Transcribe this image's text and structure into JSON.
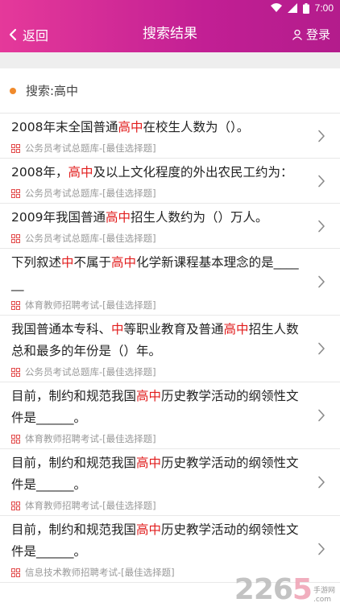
{
  "status_bar": {
    "time": "7:00"
  },
  "header": {
    "back_label": "返回",
    "title": "搜索结果",
    "login_label": "登录"
  },
  "search": {
    "label": "搜索:高中"
  },
  "results": [
    {
      "parts": [
        [
          "2008年末全国普通",
          0
        ],
        [
          "高中",
          1
        ],
        [
          "在校生人数为（）。",
          0
        ]
      ],
      "source": "公务员考试总题库-[最佳选择题]"
    },
    {
      "parts": [
        [
          "2008年，",
          0
        ],
        [
          "高中",
          1
        ],
        [
          "及以上文化程度的外出农民工约为：",
          0
        ]
      ],
      "source": "公务员考试总题库-[最佳选择题]"
    },
    {
      "parts": [
        [
          "2009年我国普通",
          0
        ],
        [
          "高中",
          1
        ],
        [
          "招生人数约为（）万人。",
          0
        ]
      ],
      "source": "公务员考试总题库-[最佳选择题]"
    },
    {
      "parts": [
        [
          "下列叙述",
          0
        ],
        [
          "中",
          1
        ],
        [
          "不属于",
          0
        ],
        [
          "高中",
          1
        ],
        [
          "化学新课程基本理念的是______",
          0
        ]
      ],
      "source": "体育教师招聘考试-[最佳选择题]"
    },
    {
      "parts": [
        [
          "我国普通本专科、",
          0
        ],
        [
          "中",
          1
        ],
        [
          "等职业教育及普通",
          0
        ],
        [
          "高中",
          1
        ],
        [
          "招生人数总和最多的年份是（）年。",
          0
        ]
      ],
      "source": "公务员考试总题库-[最佳选择题]"
    },
    {
      "parts": [
        [
          "目前，制约和规范我国",
          0
        ],
        [
          "高中",
          1
        ],
        [
          "历史教学活动的纲领性文件是______。",
          0
        ]
      ],
      "source": "体育教师招聘考试-[最佳选择题]"
    },
    {
      "parts": [
        [
          "目前，制约和规范我国",
          0
        ],
        [
          "高中",
          1
        ],
        [
          "历史教学活动的纲领性文件是______。",
          0
        ]
      ],
      "source": "体育教师招聘考试-[最佳选择题]"
    },
    {
      "parts": [
        [
          "目前，制约和规范我国",
          0
        ],
        [
          "高中",
          1
        ],
        [
          "历史教学活动的纲领性文件是______。",
          0
        ]
      ],
      "source": "信息技术教师招聘考试-[最佳选择题]"
    }
  ],
  "watermark": {
    "number_main": "226",
    "number_accent": "5",
    "side_top": "手游网",
    "side_bottom": ".com"
  },
  "colors": {
    "header": "#c21f94",
    "highlight": "#e11c1c",
    "dot": "#f08a2c"
  }
}
